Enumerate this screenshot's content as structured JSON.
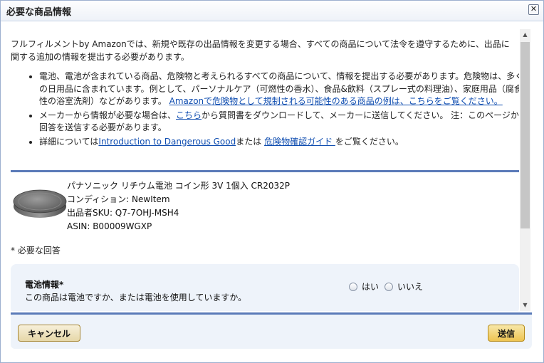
{
  "dialog": {
    "title": "必要な商品情報",
    "close_glyph": "✕"
  },
  "intro": "フルフィルメントby Amazonでは、新規や既存の出品情報を変更する場合、すべての商品について法令を遵守するために、出品に関する追加の情報を提出する必要があります。",
  "bullets": {
    "b1_text": "電池、電池が含まれている商品、危険物と考えられるすべての商品について、情報を提出する必要があります。危険物は、多くの日用品に含まれています。例として、パーソナルケア（可燃性の香水）、食品&飲料（スプレー式の料理油）、家庭用品（腐食性の浴室洗剤）などがあります。",
    "b1_link": "Amazonで危険物として規制される可能性のある商品の例は、こちらをご覧ください。",
    "b2_pre": "メーカーから情報が必要な場合は、",
    "b2_link": "こちら",
    "b2_post": "から質問書をダウンロードして、メーカーに送信してください。 注：このページから回答を送信する必要があります。",
    "b3_pre": "詳細については",
    "b3_link1": "Introduction to Dangerous Good",
    "b3_mid": "または ",
    "b3_link2": "危険物確認ガイド ",
    "b3_post": "をご覧ください。"
  },
  "product": {
    "name": "パナソニック リチウム電池 コイン形 3V 1個入 CR2032P",
    "condition": "コンディション: NewItem",
    "sku": "出品者SKU: Q7-7OHJ-MSH4",
    "asin": "ASIN: B00009WGXP"
  },
  "required_note": "* 必要な回答",
  "question": {
    "title": "電池情報*",
    "desc": "この商品は電池ですか、または電池を使用していますか。",
    "options": [
      "はい",
      "いいえ"
    ]
  },
  "footer": {
    "cancel": "キャンセル",
    "send": "送信"
  },
  "colors": {
    "accent_blue": "#5a7ab8",
    "panel_bg": "#eef3fa",
    "link": "#0f4db0",
    "button_gold": "#eec451"
  }
}
